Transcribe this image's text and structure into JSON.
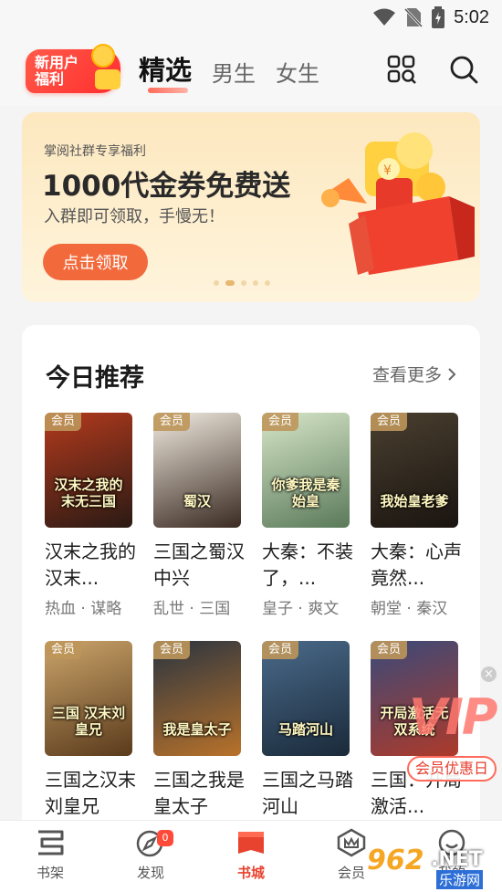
{
  "status_bar": {
    "time": "5:02"
  },
  "promo": {
    "line1": "新用户",
    "line2": "福利"
  },
  "nav": {
    "tabs": [
      "精选",
      "男生",
      "女生"
    ]
  },
  "banner": {
    "subtitle": "掌阅社群专享福利",
    "title": "1000代金券免费送",
    "desc": "入群即可领取，手慢无！",
    "cta": "点击领取"
  },
  "recommend": {
    "title": "今日推荐",
    "more": "查看更多",
    "tag": "会员",
    "books": [
      {
        "name": "汉末之我的汉末...",
        "tags": "热血 · 谋略",
        "cover_text": "汉末之我的末无三国",
        "colors": [
          "#b33a1d",
          "#2a1a14"
        ]
      },
      {
        "name": "三国之蜀汉中兴",
        "tags": "乱世 · 三国",
        "cover_text": "蜀汉",
        "colors": [
          "#f1ebe0",
          "#3a2a22"
        ]
      },
      {
        "name": "大秦：不装了，...",
        "tags": "皇子 · 爽文",
        "cover_text": "你爹我是秦始皇",
        "colors": [
          "#d7e6c8",
          "#5a7a5a"
        ]
      },
      {
        "name": "大秦：心声竟然...",
        "tags": "朝堂 · 秦汉",
        "cover_text": "我始皇老爹",
        "colors": [
          "#4a4030",
          "#1a1410"
        ]
      },
      {
        "name": "三国之汉末刘皇兄",
        "tags": "",
        "cover_text": "三国 汉末刘皇兄",
        "colors": [
          "#caa46a",
          "#5a3a1c"
        ]
      },
      {
        "name": "三国之我是皇太子",
        "tags": "",
        "cover_text": "我是皇太子",
        "colors": [
          "#2a3440",
          "#b8722a"
        ]
      },
      {
        "name": "三国之马踏河山",
        "tags": "",
        "cover_text": "马踏河山",
        "colors": [
          "#4a6a8a",
          "#1a2a3a"
        ]
      },
      {
        "name": "三国：开局激活...",
        "tags": "",
        "cover_text": "开局激活无双系统",
        "colors": [
          "#3a4a7a",
          "#ad3a2a"
        ]
      }
    ]
  },
  "vip_float": {
    "text": "VIP",
    "label": "会员优惠日"
  },
  "bottom_nav": {
    "items": [
      "书架",
      "发现",
      "书城",
      "会员",
      "我的"
    ],
    "badge": "0"
  },
  "watermark": {
    "a": "962",
    "b": ".NET",
    "c": "乐游网"
  }
}
